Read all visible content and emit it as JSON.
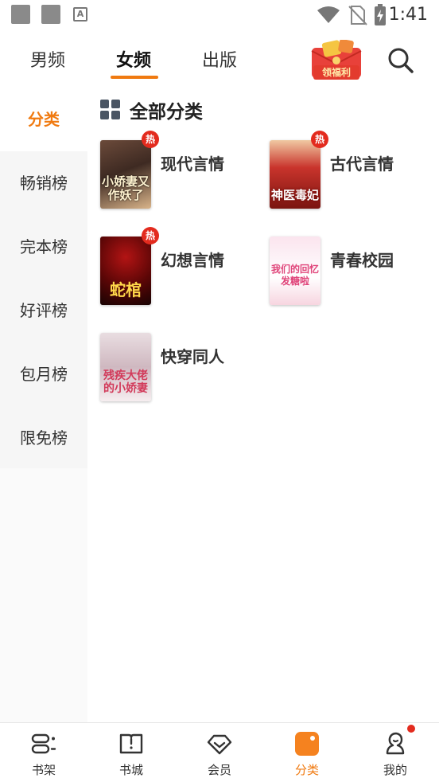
{
  "status_bar": {
    "time": "1:41",
    "a_icon_letter": "A"
  },
  "top_tabs": [
    {
      "label": "男频",
      "active": false
    },
    {
      "label": "女频",
      "active": true
    },
    {
      "label": "出版",
      "active": false
    }
  ],
  "promo": {
    "label": "领福利",
    "icon": "gift-envelope-icon"
  },
  "search": {
    "icon": "search-icon"
  },
  "sidebar": {
    "items": [
      {
        "label": "分类",
        "active": true
      },
      {
        "label": "畅销榜",
        "active": false
      },
      {
        "label": "完本榜",
        "active": false
      },
      {
        "label": "好评榜",
        "active": false
      },
      {
        "label": "包月榜",
        "active": false
      },
      {
        "label": "限免榜",
        "active": false
      }
    ]
  },
  "section": {
    "title": "全部分类",
    "icon": "grid-icon"
  },
  "categories": [
    {
      "name": "现代言情",
      "hot": true,
      "hot_label": "热",
      "cover_text": "小娇妻又作妖了",
      "cover_colors": [
        "#5a3a2c",
        "#e8c9a0"
      ]
    },
    {
      "name": "古代言情",
      "hot": true,
      "hot_label": "热",
      "cover_text": "神医毒妃",
      "cover_colors": [
        "#b32a24",
        "#f5d6b0"
      ]
    },
    {
      "name": "幻想言情",
      "hot": true,
      "hot_label": "热",
      "cover_text": "蛇棺",
      "cover_colors": [
        "#7a0d0d",
        "#1a0505"
      ]
    },
    {
      "name": "青春校园",
      "hot": false,
      "hot_label": "",
      "cover_text": "我们的回忆发糖啦",
      "cover_colors": [
        "#f8d8e4",
        "#ffffff"
      ]
    },
    {
      "name": "快穿同人",
      "hot": false,
      "hot_label": "",
      "cover_text": "残疾大佬的小娇妻",
      "cover_colors": [
        "#f3e6ea",
        "#d9c4cc"
      ]
    }
  ],
  "bottom_nav": [
    {
      "label": "书架",
      "icon": "bookshelf-icon",
      "active": false,
      "badge": false
    },
    {
      "label": "书城",
      "icon": "book-store-icon",
      "active": false,
      "badge": false
    },
    {
      "label": "会员",
      "icon": "diamond-tag-icon",
      "active": false,
      "badge": false
    },
    {
      "label": "分类",
      "icon": "category-icon",
      "active": true,
      "badge": false
    },
    {
      "label": "我的",
      "icon": "profile-icon",
      "active": false,
      "badge": true
    }
  ],
  "colors": {
    "accent": "#f07a10",
    "hot_badge": "#e32b1e"
  }
}
